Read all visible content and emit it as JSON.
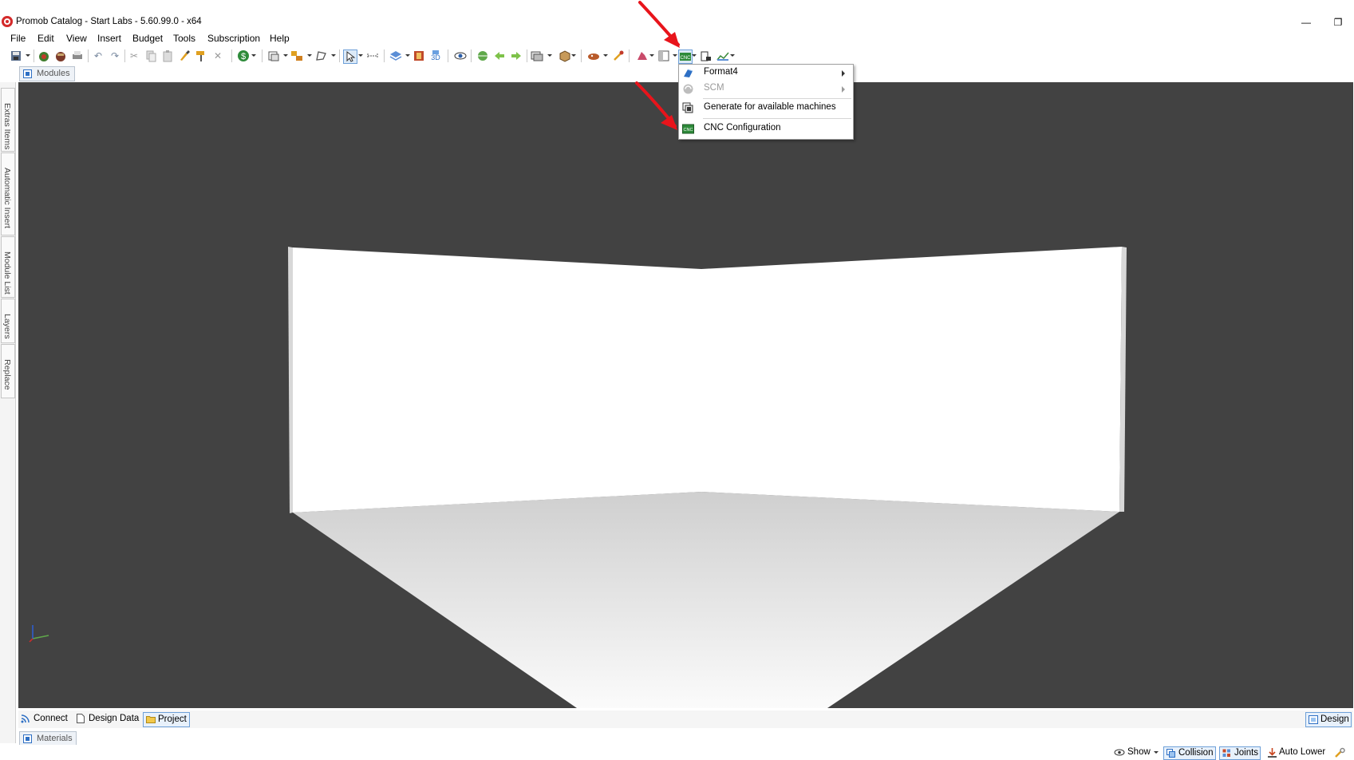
{
  "window": {
    "title": "Promob Catalog - Start Labs - 5.60.99.0 - x64",
    "minimize_glyph": "—",
    "restore_glyph": "❐"
  },
  "menu": [
    "File",
    "Edit",
    "View",
    "Insert",
    "Budget",
    "Tools",
    "Subscription",
    "Help"
  ],
  "tabs": {
    "modules": "Modules",
    "materials": "Materials"
  },
  "left_dock": [
    "Extras Items",
    "Automatic Insert",
    "Module List",
    "Layers",
    "Replace"
  ],
  "dropdown": {
    "items": [
      {
        "label": "Format4",
        "submenu": true,
        "enabled": true
      },
      {
        "label": "SCM",
        "submenu": true,
        "enabled": false
      },
      {
        "label": "Generate for available machines",
        "submenu": false,
        "enabled": true
      },
      {
        "label": "CNC Configuration",
        "submenu": false,
        "enabled": true
      }
    ]
  },
  "bottom_tabs": {
    "connect": "Connect",
    "design_data": "Design Data",
    "project": "Project",
    "design": "Design"
  },
  "status": {
    "show": "Show",
    "collision": "Collision",
    "joints": "Joints",
    "auto_lower": "Auto Lower"
  },
  "colors": {
    "viewport_bg": "#424242",
    "wall": "#ffffff",
    "annotation_arrow": "#e8141b"
  },
  "toolbar_icons": [
    "save-icon",
    "open-icon",
    "library-icon",
    "print-icon",
    "undo-icon",
    "redo-icon",
    "cut-icon",
    "copy-icon",
    "paste-icon",
    "brush-icon",
    "paint-roller-icon",
    "delete-icon",
    "budget-icon",
    "views-icon",
    "group-icon",
    "shape-icon",
    "select-icon",
    "measure-icon",
    "layers-icon",
    "render-icon",
    "3d-icon",
    "eye-icon",
    "globe-icon",
    "back-icon",
    "forward-icon",
    "camera-icon",
    "box-icon",
    "paint-icon",
    "magic-icon",
    "tool-icon",
    "layout-icon",
    "cnc-icon",
    "export-icon",
    "report-icon"
  ]
}
